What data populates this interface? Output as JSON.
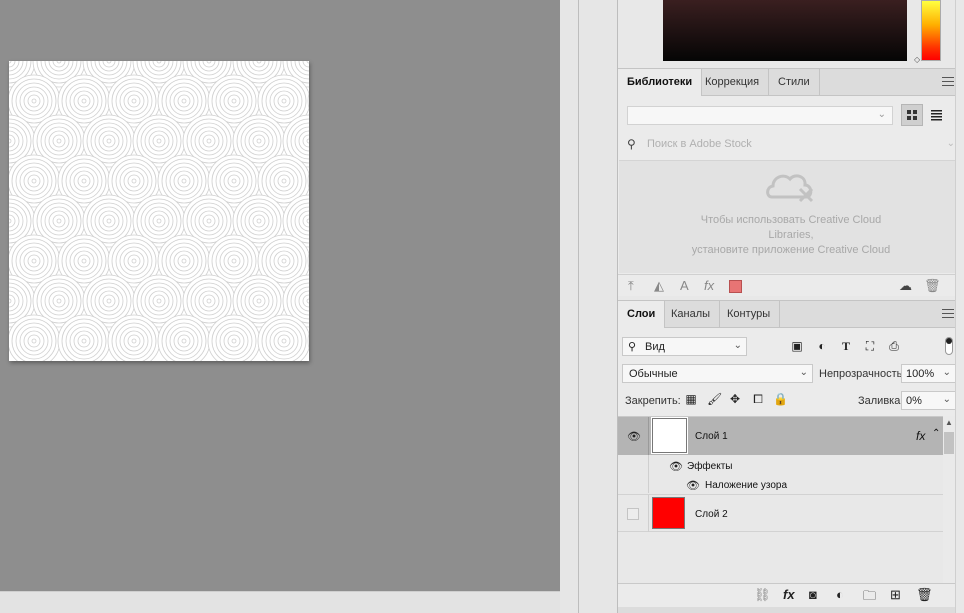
{
  "library_tabs": [
    "Библиотеки",
    "Коррекция",
    "Стили"
  ],
  "library": {
    "search_placeholder": "Поиск в Adobe Stock",
    "message_line1": "Чтобы использовать Creative Cloud",
    "message_line2": "Libraries,",
    "message_line3": "установите приложение Creative Cloud"
  },
  "layer_tabs": [
    "Слои",
    "Каналы",
    "Контуры"
  ],
  "layers_panel": {
    "filter_label": "Вид",
    "blend_mode": "Обычные",
    "opacity_label": "Непрозрачность:",
    "opacity_value": "100%",
    "lock_label": "Закрепить:",
    "fill_label": "Заливка:",
    "fill_value": "0%"
  },
  "layers": [
    {
      "name": "Слой 1",
      "thumb_color": "#ffffff",
      "visible": true,
      "selected": true,
      "fx": "fx"
    },
    {
      "name": "Слой 2",
      "thumb_color": "#ff0000",
      "visible": false,
      "selected": false
    }
  ],
  "effects": {
    "group_label": "Эффекты",
    "items": [
      "Наложение узора"
    ]
  },
  "colors": {
    "library_swatch": "#e87474",
    "selected_row": "#b4b4b4"
  }
}
